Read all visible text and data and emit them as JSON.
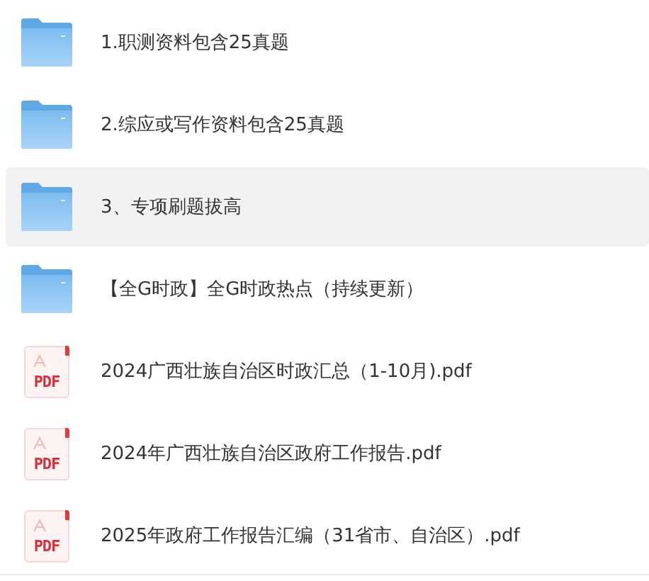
{
  "items": [
    {
      "kind": "folder",
      "name": "1.职测资料包含25真题",
      "selected": false
    },
    {
      "kind": "folder",
      "name": "2.综应或写作资料包含25真题",
      "selected": false
    },
    {
      "kind": "folder",
      "name": "3、专项刷题拔高",
      "selected": true
    },
    {
      "kind": "folder",
      "name": "【全G时政】全G时政热点（持续更新）",
      "selected": false
    },
    {
      "kind": "pdf",
      "badge": "PDF",
      "name": "2024广西壮族自治区时政汇总（1-10月).pdf",
      "selected": false
    },
    {
      "kind": "pdf",
      "badge": "PDF",
      "name": "2024年广西壮族自治区政府工作报告.pdf",
      "selected": false
    },
    {
      "kind": "pdf",
      "badge": "PDF",
      "name": "2025年政府工作报告汇编（31省市、自治区）.pdf",
      "selected": false
    }
  ]
}
